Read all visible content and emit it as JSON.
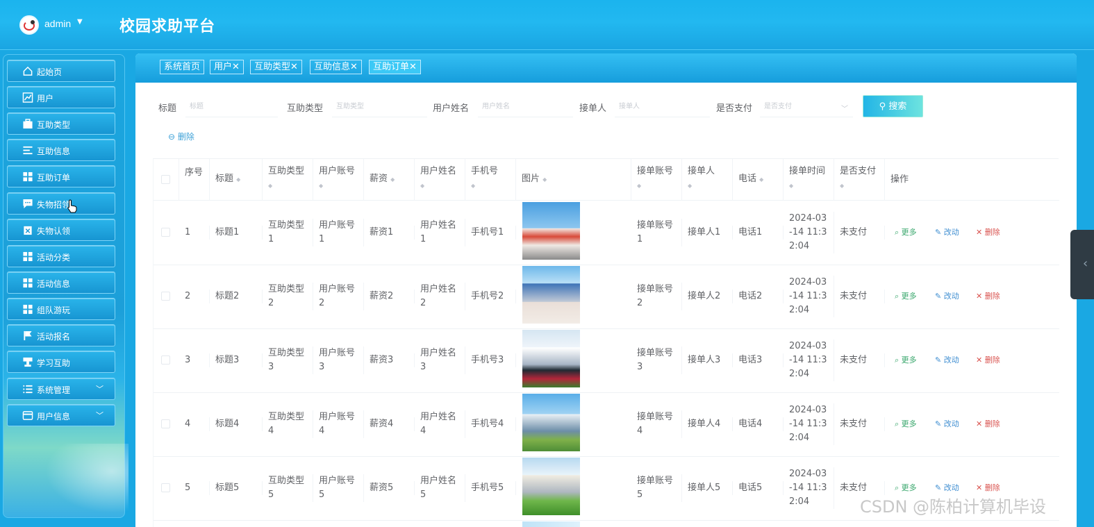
{
  "header": {
    "user": "admin",
    "app_title": "校园求助平台"
  },
  "sidebar": {
    "items": [
      {
        "label": "起始页",
        "icon": "home-icon"
      },
      {
        "label": "用户",
        "icon": "chart-icon"
      },
      {
        "label": "互助类型",
        "icon": "briefcase-icon"
      },
      {
        "label": "互助信息",
        "icon": "list-icon"
      },
      {
        "label": "互助订单",
        "icon": "grid-icon"
      },
      {
        "label": "失物招领",
        "icon": "chat-icon"
      },
      {
        "label": "失物认领",
        "icon": "clipboard-icon"
      },
      {
        "label": "活动分类",
        "icon": "grid-icon"
      },
      {
        "label": "活动信息",
        "icon": "grid-icon"
      },
      {
        "label": "组队游玩",
        "icon": "grid-icon"
      },
      {
        "label": "活动报名",
        "icon": "flag-icon"
      },
      {
        "label": "学习互助",
        "icon": "stamp-icon"
      },
      {
        "label": "系统管理",
        "icon": "list-icon",
        "expandable": true
      },
      {
        "label": "用户信息",
        "icon": "card-icon",
        "expandable": true
      }
    ]
  },
  "tabs": [
    "系统首页",
    "用户✕",
    "互助类型✕",
    "互助信息✕",
    "互助订单✕"
  ],
  "filters": {
    "title": {
      "label": "标题",
      "placeholder": "标题"
    },
    "type": {
      "label": "互助类型",
      "placeholder": "互助类型"
    },
    "username": {
      "label": "用户姓名",
      "placeholder": "用户姓名"
    },
    "taker": {
      "label": "接单人",
      "placeholder": "接单人"
    },
    "paid": {
      "label": "是否支付",
      "placeholder": "是否支付"
    },
    "search_label": "搜索",
    "delete_label": "删除"
  },
  "table": {
    "columns": [
      "序号",
      "标题",
      "互助类型",
      "用户账号",
      "薪资",
      "用户姓名",
      "手机号",
      "图片",
      "接单账号",
      "接单人",
      "电话",
      "接单时间",
      "是否支付",
      "操作"
    ],
    "rows": [
      {
        "no": "1",
        "title": "标题1",
        "type": "互助类型1",
        "account": "用户账号1",
        "salary": "薪资1",
        "name": "用户姓名1",
        "phone": "手机号1",
        "taker_account": "接单账号1",
        "taker": "接单人1",
        "tel": "电话1",
        "time": "2024-03-14 11:32:04",
        "paid": "未支付"
      },
      {
        "no": "2",
        "title": "标题2",
        "type": "互助类型2",
        "account": "用户账号2",
        "salary": "薪资2",
        "name": "用户姓名2",
        "phone": "手机号2",
        "taker_account": "接单账号2",
        "taker": "接单人2",
        "tel": "电话2",
        "time": "2024-03-14 11:32:04",
        "paid": "未支付"
      },
      {
        "no": "3",
        "title": "标题3",
        "type": "互助类型3",
        "account": "用户账号3",
        "salary": "薪资3",
        "name": "用户姓名3",
        "phone": "手机号3",
        "taker_account": "接单账号3",
        "taker": "接单人3",
        "tel": "电话3",
        "time": "2024-03-14 11:32:04",
        "paid": "未支付"
      },
      {
        "no": "4",
        "title": "标题4",
        "type": "互助类型4",
        "account": "用户账号4",
        "salary": "薪资4",
        "name": "用户姓名4",
        "phone": "手机号4",
        "taker_account": "接单账号4",
        "taker": "接单人4",
        "tel": "电话4",
        "time": "2024-03-14 11:32:04",
        "paid": "未支付"
      },
      {
        "no": "5",
        "title": "标题5",
        "type": "互助类型5",
        "account": "用户账号5",
        "salary": "薪资5",
        "name": "用户姓名5",
        "phone": "手机号5",
        "taker_account": "接单账号5",
        "taker": "接单人5",
        "tel": "电话5",
        "time": "2024-03-14 11:32:04",
        "paid": "未支付"
      }
    ],
    "actions": {
      "more": "更多",
      "edit": "改动",
      "delete": "删除"
    }
  },
  "watermark": "CSDN @陈柏计算机毕设",
  "colors": {
    "primary": "#1aa8e3",
    "more": "#3aa76d",
    "edit": "#3f8ed1",
    "delete": "#d9534f"
  }
}
